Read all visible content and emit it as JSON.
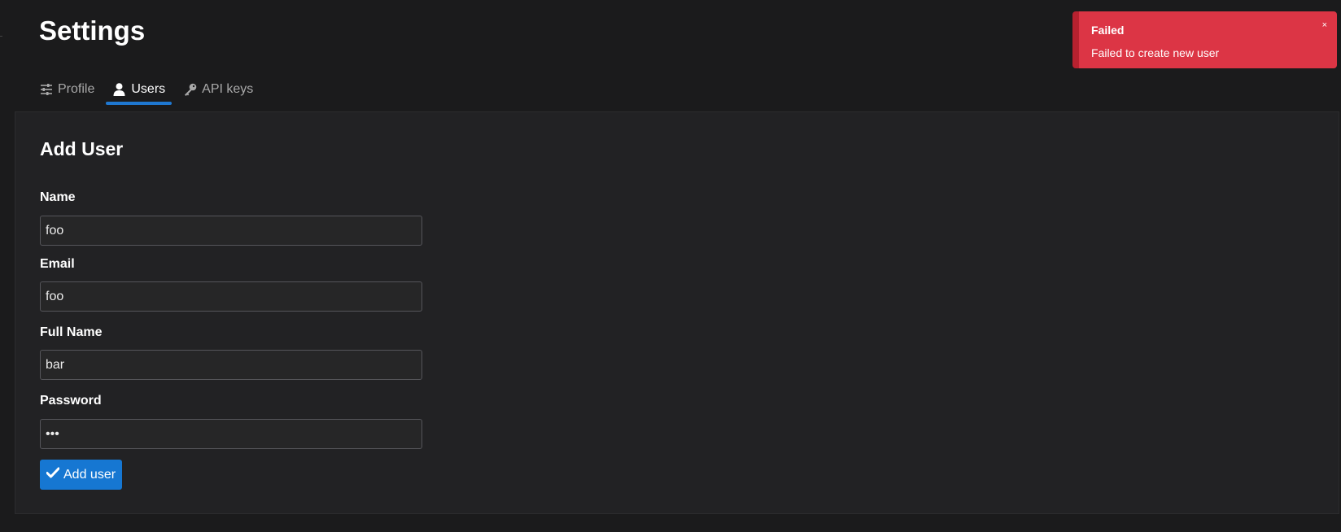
{
  "page": {
    "title": "Settings"
  },
  "tabs": [
    {
      "label": "Profile",
      "icon": "sliders-icon",
      "active": false
    },
    {
      "label": "Users",
      "icon": "user-icon",
      "active": true
    },
    {
      "label": "API keys",
      "icon": "key-icon",
      "active": false
    }
  ],
  "form": {
    "title": "Add User",
    "fields": [
      {
        "label": "Name",
        "value": "foo",
        "type": "text"
      },
      {
        "label": "Email",
        "value": "foo",
        "type": "text"
      },
      {
        "label": "Full Name",
        "value": "bar",
        "type": "text"
      },
      {
        "label": "Password",
        "value": "foo",
        "type": "password"
      }
    ],
    "submit_label": "Add user",
    "submit_icon": "check-icon"
  },
  "toast": {
    "title": "Failed",
    "message": "Failed to create new user",
    "close_symbol": "×",
    "color": "#dc3545"
  },
  "colors": {
    "accent": "#1f78d1",
    "background": "#1b1b1c",
    "panel": "#222224",
    "error": "#dc3545"
  }
}
